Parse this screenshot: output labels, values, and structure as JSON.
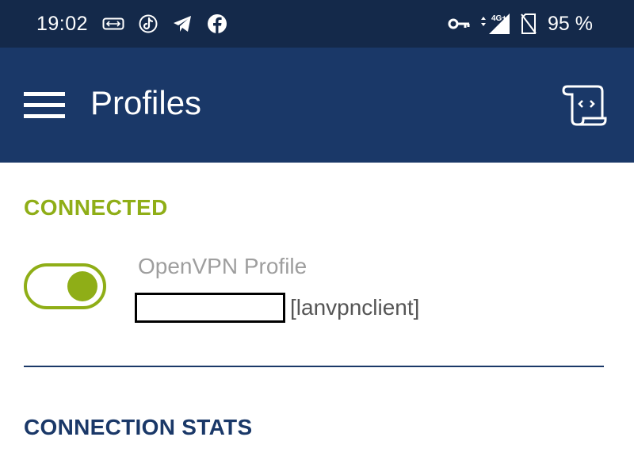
{
  "status_bar": {
    "time": "19:02",
    "battery": "95 %",
    "network": "4G+",
    "left_icons": [
      "vpn-link-icon",
      "tiktok-icon",
      "telegram-icon",
      "facebook-icon"
    ],
    "right_icons": [
      "key-icon",
      "signal-icon",
      "no-sim-icon"
    ]
  },
  "app_bar": {
    "title": "Profiles",
    "menu_icon": "hamburger-menu-icon",
    "action_icon": "log-scroll-icon"
  },
  "connection": {
    "section_label": "CONNECTED",
    "toggle_on": true,
    "profile_name": "OpenVPN Profile",
    "profile_user": "[lanvpnclient]"
  },
  "stats": {
    "section_label": "CONNECTION STATS"
  },
  "colors": {
    "status_bar_bg": "#14294a",
    "app_bar_bg": "#1a3868",
    "accent_green": "#8fae17",
    "profile_name_gray": "#9e9e9e"
  }
}
